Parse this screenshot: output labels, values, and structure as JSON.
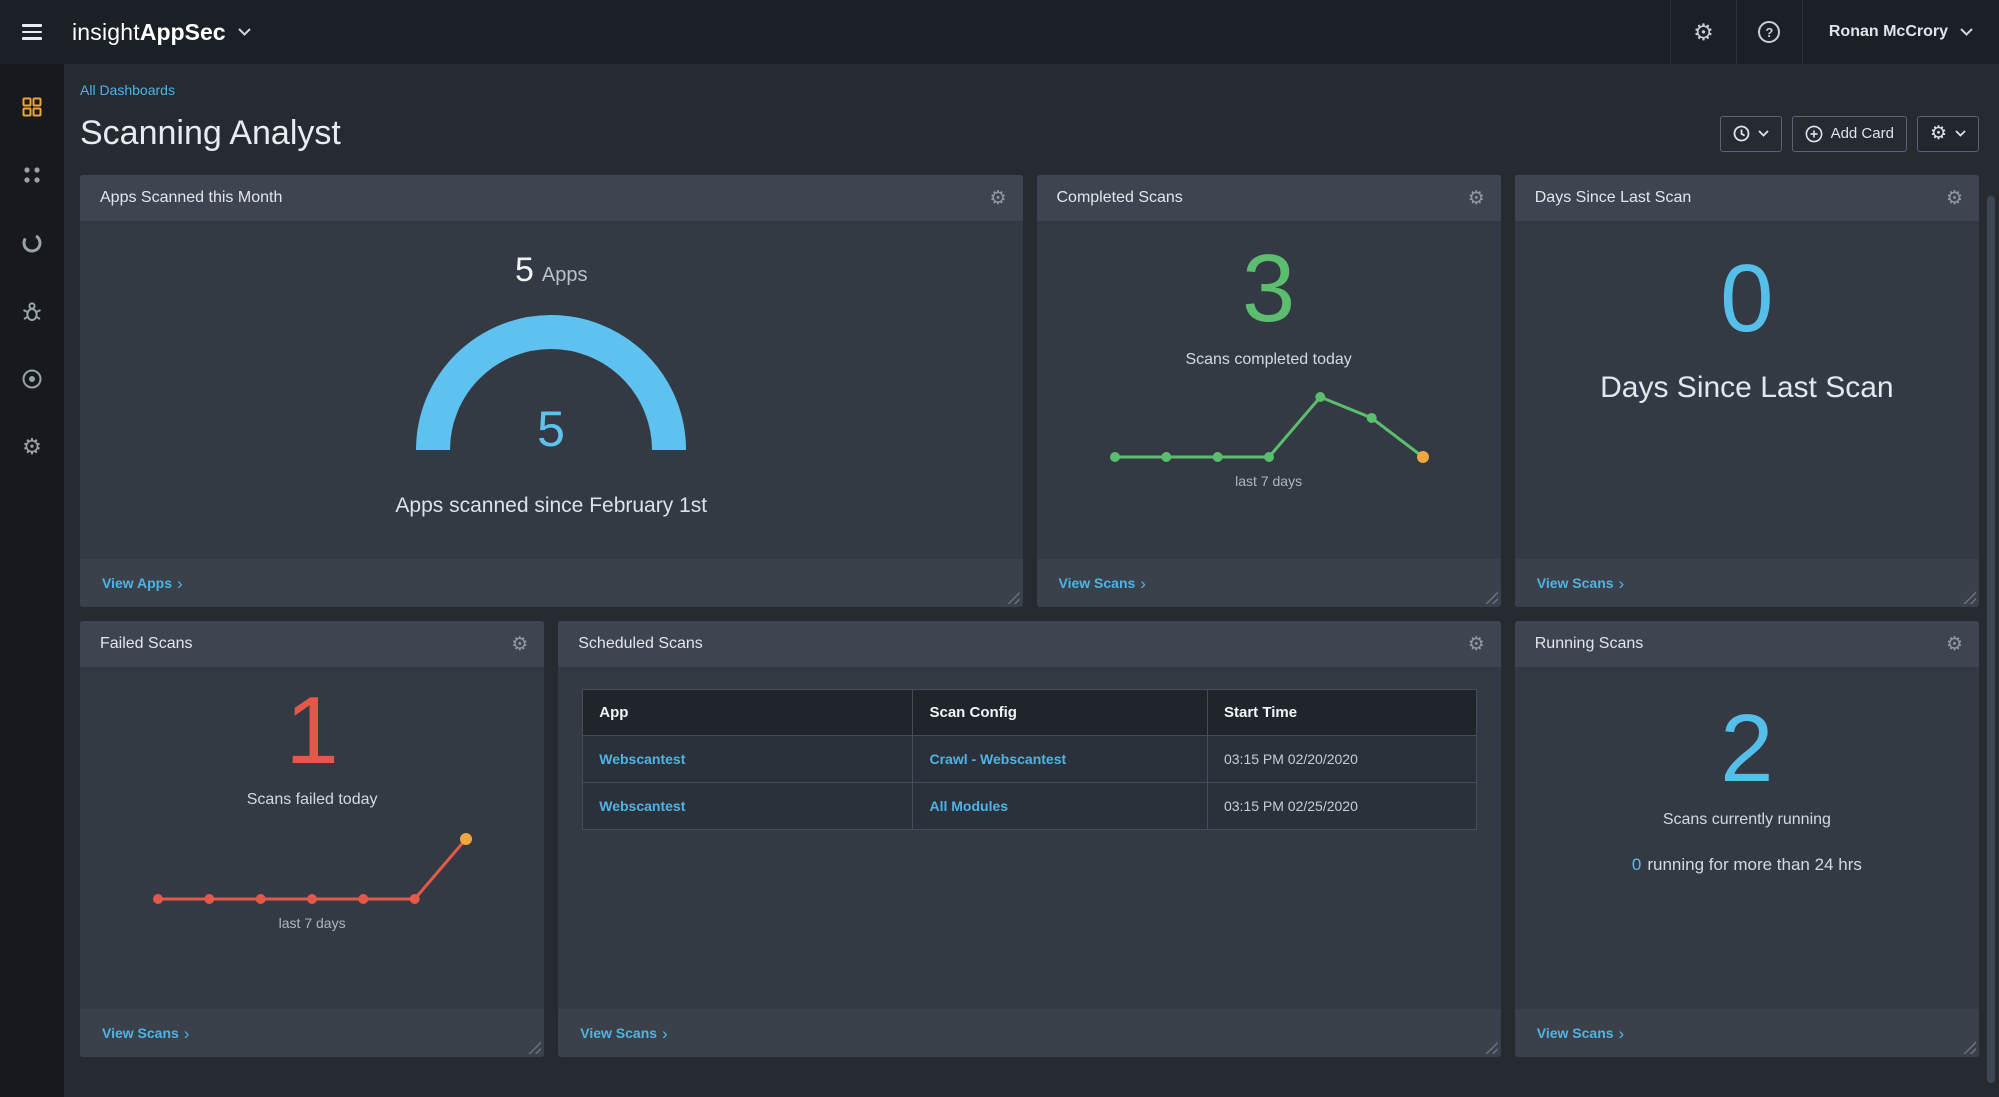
{
  "topbar": {
    "brand_prefix": "insight",
    "brand_suffix": "AppSec",
    "user_name": "Ronan McCrory"
  },
  "icons": {
    "gear": "⚙",
    "help": "?",
    "chevron_right": "›"
  },
  "sidebar": {
    "items": [
      {
        "name": "dashboards",
        "icon": "grid-icon",
        "active": true
      },
      {
        "name": "apps",
        "icon": "apps-icon",
        "active": false
      },
      {
        "name": "reports",
        "icon": "pie-chart-icon",
        "active": false
      },
      {
        "name": "vulnerabilities",
        "icon": "bug-icon",
        "active": false
      },
      {
        "name": "scans",
        "icon": "target-icon",
        "active": false
      },
      {
        "name": "settings",
        "icon": "gear-icon",
        "active": false
      }
    ]
  },
  "page": {
    "breadcrumb": "All Dashboards",
    "title": "Scanning Analyst",
    "add_card_label": "Add Card"
  },
  "colors": {
    "accent_blue": "#56bfe9",
    "link_blue": "#4db4e6",
    "green": "#5cbd6e",
    "red": "#e4584a",
    "orange": "#efa73e",
    "sidebar_active_orange": "#eda338"
  },
  "cards": {
    "apps_scanned": {
      "title": "Apps Scanned this Month",
      "stat_value": "5",
      "stat_unit": "Apps",
      "gauge": {
        "type": "gauge",
        "value": 5,
        "max": 5,
        "center_label": "5",
        "color": "#5ec1ef"
      },
      "caption": "Apps scanned since February 1st",
      "footer_link": "View Apps"
    },
    "completed_scans": {
      "title": "Completed Scans",
      "big_number": "3",
      "subtitle": "Scans completed today",
      "sparkline": {
        "type": "line",
        "values": [
          1,
          1,
          1,
          1,
          3,
          2.3,
          1
        ],
        "line_color": "#5cbd6e",
        "dot_color": "#5cbd6e",
        "last_dot_color": "#efa73e"
      },
      "caption": "last 7 days",
      "footer_link": "View Scans"
    },
    "days_since_last_scan": {
      "title": "Days Since Last Scan",
      "big_number": "0",
      "subtitle": "Days Since Last Scan",
      "footer_link": "View Scans"
    },
    "failed_scans": {
      "title": "Failed Scans",
      "big_number": "1",
      "subtitle": "Scans failed today",
      "sparkline": {
        "type": "line",
        "values": [
          0,
          0,
          0,
          0,
          0,
          0,
          1
        ],
        "line_color": "#e4584a",
        "dot_color": "#e4584a",
        "last_dot_color": "#efa73e"
      },
      "caption": "last 7 days",
      "footer_link": "View Scans"
    },
    "scheduled_scans": {
      "title": "Scheduled Scans",
      "table": {
        "headers": [
          "App",
          "Scan Config",
          "Start Time"
        ],
        "link_columns": [
          0,
          1
        ],
        "rows": [
          [
            "Webscantest",
            "Crawl - Webscantest",
            "03:15 PM 02/20/2020"
          ],
          [
            "Webscantest",
            "All Modules",
            "03:15 PM 02/25/2020"
          ]
        ]
      },
      "footer_link": "View Scans"
    },
    "running_scans": {
      "title": "Running Scans",
      "big_number": "2",
      "subtitle": "Scans currently running",
      "note_count": "0",
      "note_text": "running for more than 24 hrs",
      "footer_link": "View Scans"
    }
  }
}
